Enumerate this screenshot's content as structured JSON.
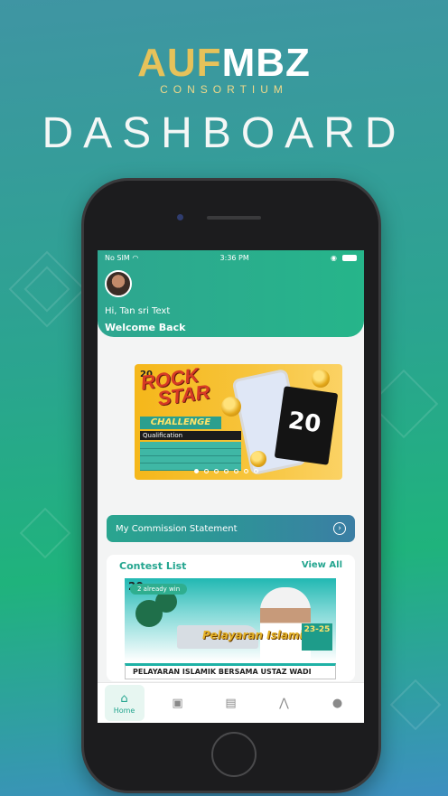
{
  "brand": {
    "logo_mark_left": "AUF",
    "logo_mark_right": "MBZ",
    "logo_sub": "CONSORTIUM",
    "headline": "DASHBOARD"
  },
  "status_bar": {
    "carrier": "No SIM",
    "time": "3:36 PM"
  },
  "profile": {
    "greeting": "Hi, Tan sri Text",
    "welcome": "Welcome Back"
  },
  "banner": {
    "title_line1": "ROCK",
    "title_line2": "STAR",
    "subtitle": "CHALLENGE",
    "section": "Qualification",
    "badge": "20",
    "anniversary_number": "20",
    "carousel_dot_count": 7,
    "carousel_active_index": 0
  },
  "commission": {
    "label": "My Commission Statement",
    "arrow": "›"
  },
  "contests": {
    "heading": "Contest List",
    "view_all": "View All",
    "badge_number": "20",
    "already_win": "2 already win",
    "image_title": "Pelayaran Islamik",
    "image_date": "23-25",
    "item_title": "PELAYARAN ISLAMIK BERSAMA USTAZ WADI"
  },
  "tabbar": {
    "home_label": "Home"
  },
  "colors": {
    "accent": "#24a58f",
    "banner_yellow": "#f5b71a",
    "headline": "#f4f7f6"
  }
}
